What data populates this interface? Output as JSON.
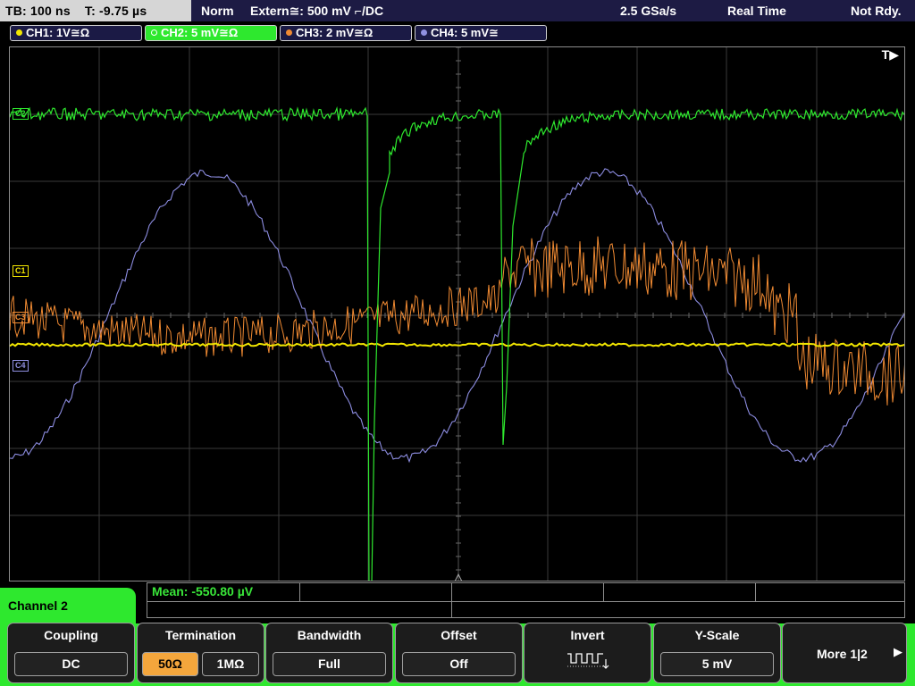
{
  "status": {
    "timebase": "TB: 100 ns",
    "trigger_time": "T: -9.75 µs",
    "mode": "Norm",
    "trigger_source": "Extern≅: 500 mV ⌐/DC",
    "sample_rate": "2.5 GSa/s",
    "acquisition": "Real Time",
    "readiness": "Not Rdy."
  },
  "channels": [
    {
      "label": "CH1: 1V≅Ω",
      "color": "#f2e600"
    },
    {
      "label": "CH2: 5 mV≅Ω",
      "color": "#2ee82e"
    },
    {
      "label": "CH3: 2 mV≅Ω",
      "color": "#f08a32"
    },
    {
      "label": "CH4: 5 mV≅",
      "color": "#9090e0"
    }
  ],
  "screen": {
    "trigger_indicator": "T▶",
    "markers": {
      "c1": "C1",
      "c3": "C3",
      "c4": "C4",
      "c2": "C2"
    }
  },
  "measurement": {
    "label": "Mean: -550.80 µV"
  },
  "menu_title": "Channel 2",
  "softkeys": {
    "coupling": {
      "title": "Coupling",
      "value": "DC"
    },
    "termination": {
      "title": "Termination",
      "opt_50": "50Ω",
      "opt_1m": "1MΩ"
    },
    "bandwidth": {
      "title": "Bandwidth",
      "value": "Full"
    },
    "offset": {
      "title": "Offset",
      "value": "Off"
    },
    "invert": {
      "title": "Invert"
    },
    "yscale": {
      "title": "Y-Scale",
      "value": "5 mV"
    },
    "more": {
      "label": "More 1|2"
    }
  }
}
